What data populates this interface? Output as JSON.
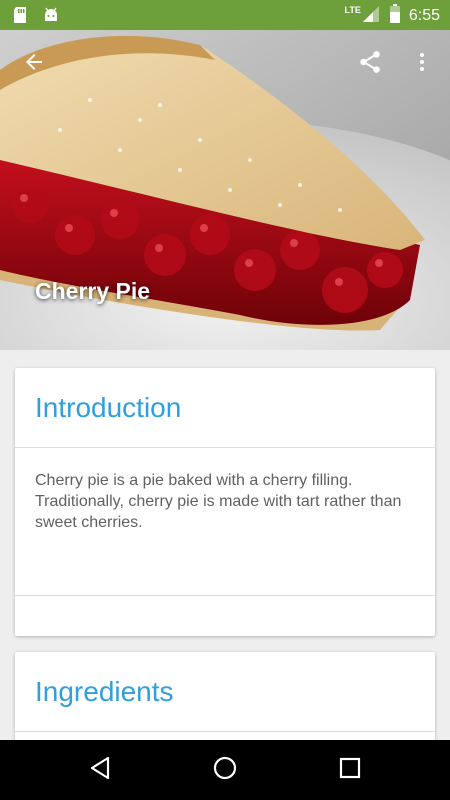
{
  "status_bar": {
    "time": "6:55",
    "network": "LTE",
    "icons": [
      "sd-card-icon",
      "android-icon",
      "signal-icon",
      "battery-icon"
    ]
  },
  "toolbar": {
    "icons": [
      "arrow-back-icon",
      "share-icon",
      "more-vert-icon"
    ]
  },
  "hero": {
    "title": "Cherry Pie"
  },
  "sections": [
    {
      "title": "Introduction",
      "body": "Cherry pie is a pie baked with a cherry filling. Traditionally, cherry pie is made with tart rather than sweet cherries."
    },
    {
      "title": "Ingredients"
    }
  ],
  "nav_bar": {
    "icons": [
      "nav-back-icon",
      "nav-home-icon",
      "nav-recents-icon"
    ]
  },
  "colors": {
    "status_bar": "#6da03b",
    "accent": "#2f9fe0",
    "card_text": "#606060"
  }
}
